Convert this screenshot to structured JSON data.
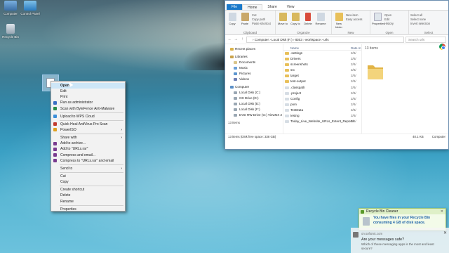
{
  "desktop": {
    "icons": [
      {
        "label": "Computer",
        "icon": "computer-icon"
      },
      {
        "label": "Control Panel",
        "icon": "control-panel-icon"
      },
      {
        "label": "Recycle Bin",
        "icon": "recycle-bin-icon"
      }
    ],
    "selected_file_icon": "file-icon"
  },
  "context_menu": {
    "items": [
      {
        "label": "Open",
        "bold": true
      },
      {
        "label": "Edit"
      },
      {
        "label": "Print"
      },
      {
        "label": "Run as administrator",
        "icon": "shield-icon"
      },
      {
        "label": "Scan with ByteFence Anti-Malware",
        "icon": "bytefence-icon"
      },
      {
        "sep": true
      },
      {
        "label": "Upload to WPS Cloud",
        "icon": "wps-cloud-icon"
      },
      {
        "sep": true
      },
      {
        "label": "Quick Heal AntiVirus Pro Scan",
        "icon": "quickheal-icon"
      },
      {
        "label": "PowerISO",
        "icon": "poweriso-icon",
        "submenu": true
      },
      {
        "sep": true
      },
      {
        "label": "Share with",
        "submenu": true
      },
      {
        "label": "Add to archive...",
        "icon": "winrar-icon"
      },
      {
        "label": "Add to \"URLs.rar\"",
        "icon": "winrar-icon"
      },
      {
        "label": "Compress and email...",
        "icon": "winrar-icon"
      },
      {
        "label": "Compress to \"URLs.rar\" and email",
        "icon": "winrar-icon"
      },
      {
        "sep": true
      },
      {
        "label": "Send to",
        "submenu": true
      },
      {
        "sep": true
      },
      {
        "label": "Cut"
      },
      {
        "label": "Copy"
      },
      {
        "sep": true
      },
      {
        "label": "Create shortcut"
      },
      {
        "label": "Delete"
      },
      {
        "label": "Rename"
      },
      {
        "sep": true
      },
      {
        "label": "Properties"
      }
    ]
  },
  "explorer": {
    "tabs": [
      "File",
      "Home",
      "Share",
      "View"
    ],
    "ribbon": {
      "clipboard": {
        "name": "Clipboard",
        "copy": "Copy",
        "paste": "Paste",
        "cut": "Cut",
        "copy_path": "Copy path",
        "paste_shortcut": "Paste shortcut"
      },
      "organize": {
        "name": "Organize",
        "move_to": "Move to",
        "copy_to": "Copy to",
        "delete": "Delete",
        "rename": "Rename"
      },
      "new": {
        "name": "New",
        "new_folder": "New folder",
        "new_item": "New item",
        "easy_access": "Easy access"
      },
      "open": {
        "name": "Open",
        "properties": "Properties",
        "open": "Open",
        "edit": "Edit",
        "history": "History"
      },
      "select": {
        "name": "Select",
        "select_all": "Select all",
        "select_none": "Select none",
        "invert": "Invert selection"
      }
    },
    "address": "› Computer › Local Disk (F:) › IDE3 › workspace › urls",
    "search_placeholder": "Search urls",
    "nav": [
      {
        "label": "Recent places",
        "top": true,
        "color": "#d9b24a"
      },
      {
        "label": "Libraries",
        "top": true,
        "color": "#c9a24a"
      },
      {
        "label": "Documents",
        "color": "#d9c58a"
      },
      {
        "label": "Music",
        "color": "#6aa0d8"
      },
      {
        "label": "Pictures",
        "color": "#5b95cf"
      },
      {
        "label": "Videos",
        "color": "#6e7fb5"
      },
      {
        "label": "Computer",
        "top": true,
        "color": "#5b8fc7"
      },
      {
        "label": "Local Disk (C:)",
        "color": "#9aa7b3"
      },
      {
        "label": "CD Drive (D:)",
        "color": "#9aa7b3"
      },
      {
        "label": "Local Disk (E:)",
        "color": "#9aa7b3"
      },
      {
        "label": "Local Disk (F:)",
        "color": "#9aa7b3"
      },
      {
        "label": "DVD RW Drive (G:) ViewNX 2",
        "color": "#9aa7b3"
      }
    ],
    "column_header": {
      "name": "Name",
      "date": "Date m"
    },
    "files": [
      {
        "name": ".settings",
        "date": "2/6/",
        "type": "folder"
      },
      {
        "name": "Drivers",
        "date": "2/6/",
        "type": "folder"
      },
      {
        "name": "screenshots",
        "date": "2/6/",
        "type": "folder"
      },
      {
        "name": "src",
        "date": "2/6/",
        "type": "folder"
      },
      {
        "name": "target",
        "date": "2/6/",
        "type": "folder"
      },
      {
        "name": "test-output",
        "date": "2/6/",
        "type": "folder"
      },
      {
        "name": ".classpath",
        "date": "2/6/",
        "type": "file"
      },
      {
        "name": ".project",
        "date": "2/6/",
        "type": "file"
      },
      {
        "name": "Config",
        "date": "2/6/",
        "type": "file"
      },
      {
        "name": "pom",
        "date": "2/6/",
        "type": "file"
      },
      {
        "name": "TestData",
        "date": "2/6/",
        "type": "file"
      },
      {
        "name": "testng",
        "date": "2/6/",
        "type": "file"
      },
      {
        "name": "Today_Live_Website_URLs_Extent_Reports",
        "date": "2/6/",
        "type": "file"
      }
    ],
    "nav_count": "13 items",
    "preview_count": "13 items",
    "status": {
      "left": "13 items (Disk free space: 338 GB)",
      "size": "40.1 KB",
      "computer": "Computer"
    }
  },
  "notification": {
    "title": "Recycle Bin Cleaner",
    "line1": "You have files in your Recycle Bin",
    "line2": "consuming 4 GB of disk space."
  },
  "toast": {
    "site": "on.softonic.com",
    "title": "Are your messages safe?",
    "body": "Which of these messaging apps is the most and least secure?"
  },
  "colors": {
    "accent": "#1979ca",
    "folder": "#e8c05a",
    "notif_text": "#1d62a8"
  }
}
